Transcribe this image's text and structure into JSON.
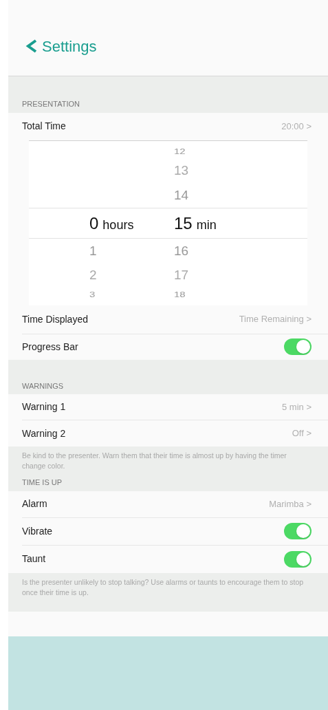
{
  "nav": {
    "back_label": "Settings"
  },
  "presentation": {
    "header": "PRESENTATION",
    "total_time": {
      "kind": "value",
      "label": "Total Time",
      "value": "20:00 >"
    },
    "picker": {
      "hours": {
        "selected": {
          "value": "0",
          "unit": "hours"
        },
        "below": [
          "1",
          "2",
          "3"
        ]
      },
      "minutes": {
        "above": [
          "12",
          "13",
          "14"
        ],
        "selected": {
          "value": "15",
          "unit": "min"
        },
        "below": [
          "16",
          "17",
          "18"
        ]
      }
    },
    "rows": [
      {
        "kind": "value",
        "label": "Time Displayed",
        "value": "Time Remaining >"
      },
      {
        "kind": "toggle",
        "label": "Progress Bar",
        "on": true
      }
    ]
  },
  "warnings": {
    "header": "WARNINGS",
    "rows": [
      {
        "kind": "value",
        "label": "Warning 1",
        "value": "5 min >"
      },
      {
        "kind": "value",
        "label": "Warning 2",
        "value": "Off >"
      }
    ],
    "footer": "Be kind to the presenter. Warn them that their time is almost up by having the timer change color."
  },
  "time_is_up": {
    "header": "TIME IS UP",
    "rows": [
      {
        "kind": "value",
        "label": "Alarm",
        "value": "Marimba >"
      },
      {
        "kind": "toggle",
        "label": "Vibrate",
        "on": true
      },
      {
        "kind": "toggle",
        "label": "Taunt",
        "on": true
      }
    ],
    "footer": "Is the presenter unlikely to stop talking? Use alarms or taunts to encourage them to stop once their time is up."
  }
}
